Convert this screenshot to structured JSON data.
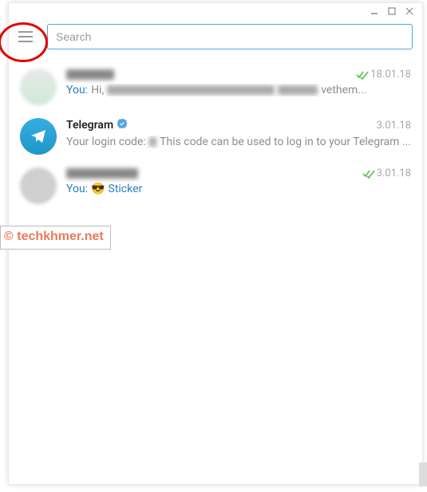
{
  "search": {
    "placeholder": "Search"
  },
  "watermark": "© techkhmer.net",
  "chats": [
    {
      "date": "18.01.18",
      "you_prefix": "You:",
      "msg_prefix": "Hi,",
      "msg_suffix": "vethem..."
    },
    {
      "name": "Telegram",
      "date": "3.01.18",
      "msg_prefix": "Your login code:",
      "msg_suffix": "This code can be used to log in to your Telegram ..."
    },
    {
      "date": "3.01.18",
      "you_prefix": "You:",
      "sticker_label": "Sticker",
      "emoji": "😎"
    }
  ]
}
